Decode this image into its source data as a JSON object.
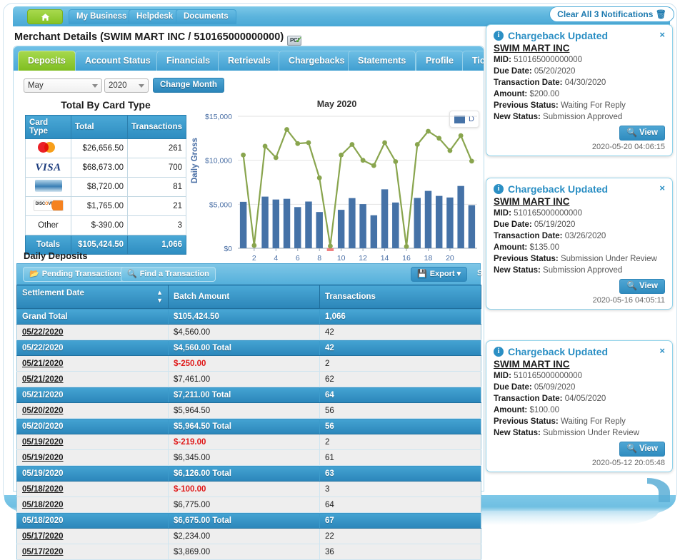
{
  "topnav": {
    "home_icon": "home-icon",
    "items": [
      {
        "label": "My Business"
      },
      {
        "label": "Helpdesk"
      },
      {
        "label": "Documents"
      }
    ]
  },
  "page": {
    "title": "Merchant Details (SWIM MART INC /  510165000000000)",
    "pci_badge": "PCI",
    "pci_check": "✓"
  },
  "tabs": [
    {
      "label": "Deposits",
      "active": true
    },
    {
      "label": "Account Status",
      "active": false
    },
    {
      "label": "Financials",
      "active": false
    },
    {
      "label": "Retrievals",
      "active": false
    },
    {
      "label": "Chargebacks",
      "active": false
    },
    {
      "label": "Statements",
      "active": false
    },
    {
      "label": "Profile",
      "active": false
    },
    {
      "label": "Tic",
      "active": false
    }
  ],
  "month_selector": {
    "month": "May",
    "year": "2020",
    "button": "Change Month"
  },
  "card_type": {
    "title": "Total By Card Type",
    "headers": [
      "Card Type",
      "Total",
      "Transactions"
    ],
    "rows": [
      {
        "brand": "mastercard",
        "label": "",
        "total": "$26,656.50",
        "transactions": "261"
      },
      {
        "brand": "visa",
        "label": "",
        "total": "$68,673.00",
        "transactions": "700"
      },
      {
        "brand": "amex",
        "label": "",
        "total": "$8,720.00",
        "transactions": "81"
      },
      {
        "brand": "discover",
        "label": "",
        "total": "$1,765.00",
        "transactions": "21"
      },
      {
        "brand": "text",
        "label": "Other",
        "total": "$-390.00",
        "transactions": "3"
      }
    ],
    "totals": {
      "label": "Totals",
      "total": "$105,424.50",
      "transactions": "1,066"
    }
  },
  "chart_data": {
    "type": "bar",
    "title": "May 2020",
    "xlabel": "",
    "ylabel": "Daily Gross",
    "ylim": [
      0,
      15000
    ],
    "yticks": [
      0,
      5000,
      10000,
      15000
    ],
    "ytick_labels": [
      "$0",
      "$5,000",
      "$10,000",
      "$15,000"
    ],
    "xticks": [
      2,
      4,
      6,
      8,
      10,
      12,
      14,
      16,
      18,
      20
    ],
    "grid": true,
    "legend_position": "top-right",
    "legend_truncated_label": "D",
    "categories": [
      1,
      2,
      3,
      4,
      5,
      6,
      7,
      8,
      9,
      10,
      11,
      12,
      13,
      14,
      15,
      16,
      17,
      18,
      19,
      20,
      21,
      22
    ],
    "series": [
      {
        "name": "Daily Gross",
        "type": "bar",
        "color": "#4572a7",
        "values": [
          5280,
          0,
          5870,
          5540,
          5620,
          4680,
          5310,
          4120,
          0,
          4370,
          5700,
          5020,
          3750,
          6700,
          5200,
          0,
          5720,
          6520,
          5950,
          5770,
          7080,
          4900
        ]
      },
      {
        "name": "Transactions Line",
        "type": "line",
        "color": "#89a54e",
        "values": [
          10600,
          320,
          11600,
          10300,
          13500,
          11900,
          12000,
          8000,
          250,
          10600,
          11800,
          10000,
          9400,
          12000,
          9850,
          200,
          11800,
          13300,
          12500,
          11100,
          12800,
          9900
        ]
      }
    ],
    "negative_markers": [
      {
        "x": 9,
        "color": "#f08080"
      }
    ]
  },
  "daily_deposits": {
    "title": "Daily Deposits",
    "toolbar": {
      "pending_label": "Pending Transactions",
      "find_label": "Find a Transaction",
      "export_label": "Export",
      "search_label": "S"
    },
    "headers": [
      "Settlement Date",
      "Batch Amount",
      "Transactions"
    ],
    "rows": [
      {
        "date": "Grand Total",
        "amount": "$105,424.50",
        "txns": "1,066",
        "kind": "grand"
      },
      {
        "date": "05/22/2020",
        "amount": "$4,560.00",
        "txns": "42",
        "kind": "normal"
      },
      {
        "date": "05/22/2020",
        "amount": "$4,560.00 Total",
        "txns": "42",
        "kind": "total"
      },
      {
        "date": "05/21/2020",
        "amount": "$-250.00",
        "txns": "2",
        "kind": "negative"
      },
      {
        "date": "05/21/2020",
        "amount": "$7,461.00",
        "txns": "62",
        "kind": "normal"
      },
      {
        "date": "05/21/2020",
        "amount": "$7,211.00 Total",
        "txns": "64",
        "kind": "total"
      },
      {
        "date": "05/20/2020",
        "amount": "$5,964.50",
        "txns": "56",
        "kind": "normal"
      },
      {
        "date": "05/20/2020",
        "amount": "$5,964.50 Total",
        "txns": "56",
        "kind": "total"
      },
      {
        "date": "05/19/2020",
        "amount": "$-219.00",
        "txns": "2",
        "kind": "negative"
      },
      {
        "date": "05/19/2020",
        "amount": "$6,345.00",
        "txns": "61",
        "kind": "normal"
      },
      {
        "date": "05/19/2020",
        "amount": "$6,126.00 Total",
        "txns": "63",
        "kind": "total"
      },
      {
        "date": "05/18/2020",
        "amount": "$-100.00",
        "txns": "3",
        "kind": "negative"
      },
      {
        "date": "05/18/2020",
        "amount": "$6,775.00",
        "txns": "64",
        "kind": "normal"
      },
      {
        "date": "05/18/2020",
        "amount": "$6,675.00 Total",
        "txns": "67",
        "kind": "total"
      },
      {
        "date": "05/17/2020",
        "amount": "$2,234.00",
        "txns": "22",
        "kind": "normal"
      },
      {
        "date": "05/17/2020",
        "amount": "$3,869.00",
        "txns": "36",
        "kind": "normal"
      }
    ]
  },
  "notifications": {
    "clear_all_label": "Clear All 3 Notifications",
    "trash_icon": "🗑",
    "close_icon": "×",
    "view_label": "View",
    "labels": {
      "mid": "MID:",
      "due_date": "Due Date:",
      "transaction_date": "Transaction Date:",
      "amount": "Amount:",
      "previous_status": "Previous Status:",
      "new_status": "New Status:"
    },
    "cards": [
      {
        "heading": "Chargeback Updated",
        "merchant": "SWIM MART INC",
        "mid": "510165000000000",
        "due_date": "05/20/2020",
        "transaction_date": "04/30/2020",
        "amount": "$200.00",
        "previous_status": "Waiting For Reply",
        "new_status": "Submission Approved",
        "timestamp": "2020-05-20 04:06:15"
      },
      {
        "heading": "Chargeback Updated",
        "merchant": "SWIM MART INC",
        "mid": "510165000000000",
        "due_date": "05/19/2020",
        "transaction_date": "03/26/2020",
        "amount": "$135.00",
        "previous_status": "Submission Under Review",
        "new_status": "Submission Approved",
        "timestamp": "2020-05-16 04:05:11"
      },
      {
        "heading": "Chargeback Updated",
        "merchant": "SWIM MART INC",
        "mid": "510165000000000",
        "due_date": "05/09/2020",
        "transaction_date": "04/05/2020",
        "amount": "$100.00",
        "previous_status": "Waiting For Reply",
        "new_status": "Submission Under Review",
        "timestamp": "2020-05-12 20:05:48"
      }
    ]
  },
  "colors": {
    "accent_blue": "#2b8fc4",
    "bar_blue": "#4572a7",
    "line_green": "#89a54e",
    "tab_green": "#85c225",
    "negative_red": "#e01b1b"
  }
}
